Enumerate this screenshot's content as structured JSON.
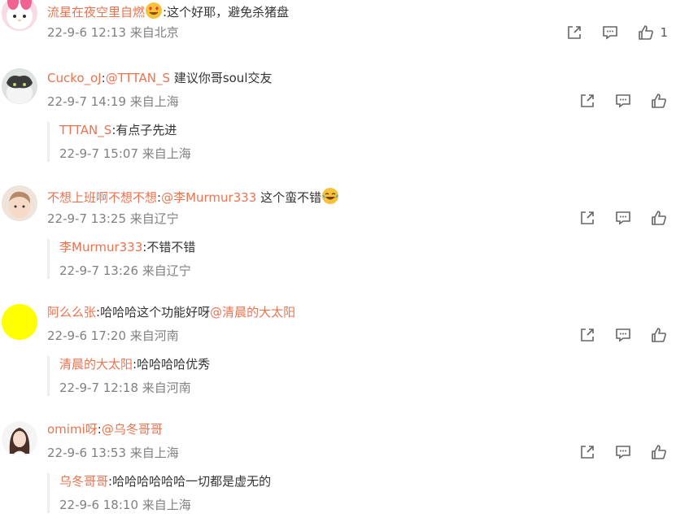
{
  "colors": {
    "username": "#eb7350",
    "meta": "#808080",
    "icon": "#666666"
  },
  "icons": {
    "share": "share-icon",
    "comment": "comment-icon",
    "like": "thumbs-up-icon"
  },
  "comments": [
    {
      "username": "流星在夜空里自燃",
      "text": ":这个好耶，避免杀猪盘",
      "time": "22-9-6 12:13",
      "location": "来自北京",
      "likes": "1",
      "avatar": "pink-cartoon-avatar"
    },
    {
      "username": "Cucko_oJ",
      "mention": "@TTTAN_S",
      "text": " 建议你哥soul交友",
      "time": "22-9-7 14:19",
      "location": "来自上海",
      "avatar": "cat-avatar",
      "reply": {
        "username": "TTTAN_S",
        "text": ":有点子先进",
        "time": "22-9-7 15:07",
        "location": "来自上海"
      }
    },
    {
      "username": "不想上班啊不想不想",
      "mention": "@李Murmur333",
      "text": " 这个蛮不错",
      "time": "22-9-7 13:25",
      "location": "来自辽宁",
      "avatar": "child-avatar",
      "reply": {
        "username": "李Murmur333",
        "text": ":不错不错",
        "time": "22-9-7 13:26",
        "location": "来自辽宁"
      }
    },
    {
      "username": "阿么么张",
      "text": ":哈哈哈这个功能好呀",
      "mention": "@清晨的大太阳",
      "time": "22-9-6 17:20",
      "location": "来自河南",
      "avatar": "yellow-circle-avatar",
      "reply": {
        "username": "清晨的大太阳",
        "text": ":哈哈哈哈优秀",
        "time": "22-9-7 12:18",
        "location": "来自河南"
      }
    },
    {
      "username": "omimi呀",
      "mention": "@乌冬哥哥",
      "text": "",
      "time": "22-9-6 13:53",
      "location": "来自上海",
      "avatar": "girl-avatar",
      "reply": {
        "username": "乌冬哥哥",
        "text": ":哈哈哈哈哈哈一切都是虚无的",
        "time": "22-9-6 18:10",
        "location": "来自上海"
      }
    }
  ]
}
